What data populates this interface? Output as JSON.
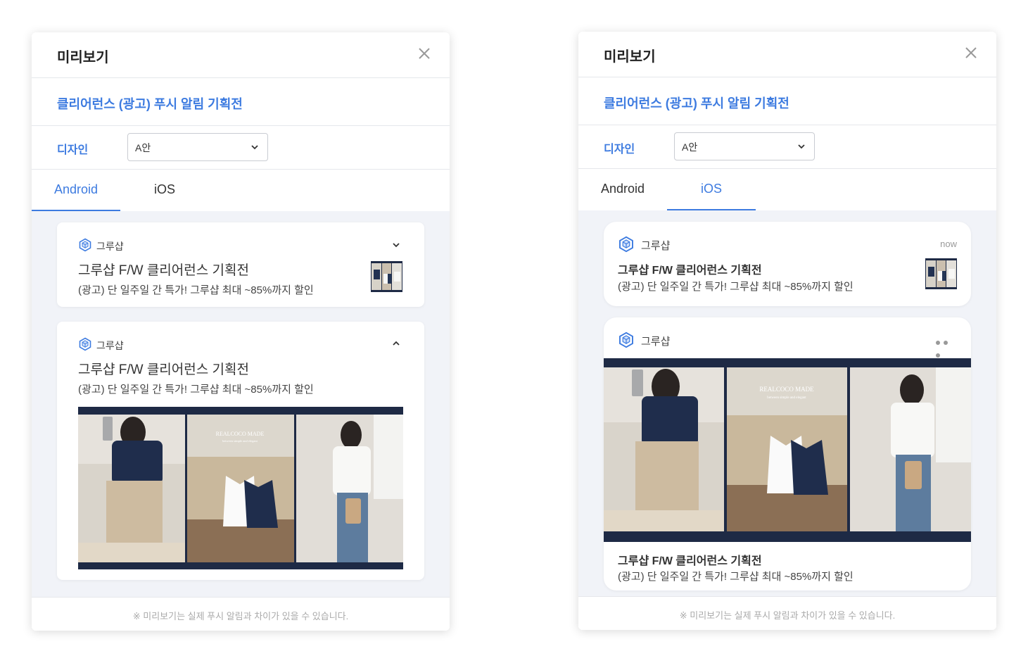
{
  "common": {
    "modal_title": "미리보기",
    "campaign_title": "클리어런스 (광고) 푸시 알림 기획전",
    "design_label": "디자인",
    "design_value": "A안",
    "tab_android": "Android",
    "tab_ios": "iOS",
    "footer_note": "※ 미리보기는 실제 푸시 알림과 차이가 있을 수 있습니다."
  },
  "notification": {
    "app_name": "그루샵",
    "title": "그루샵 F/W 클리어런스 기획전",
    "body": "(광고) 단 일주일 간 특가! 그루샵 최대 ~85%까지 할인",
    "time": "now",
    "banner_brand": "REALCOCO MADE",
    "banner_sub": "between simple and elegant"
  },
  "left_panel": {
    "active_tab": "Android"
  },
  "right_panel": {
    "active_tab": "iOS"
  },
  "colors": {
    "accent": "#3d7be0",
    "panel_bg": "#f1f3f8",
    "banner_navy": "#1e2a45"
  },
  "icons": {
    "close": "close-icon",
    "select_arrow": "chevron-down-icon",
    "app_logo": "hexagon-cube-icon",
    "collapse": "chevron-up-icon",
    "more": "more-dots-icon"
  }
}
